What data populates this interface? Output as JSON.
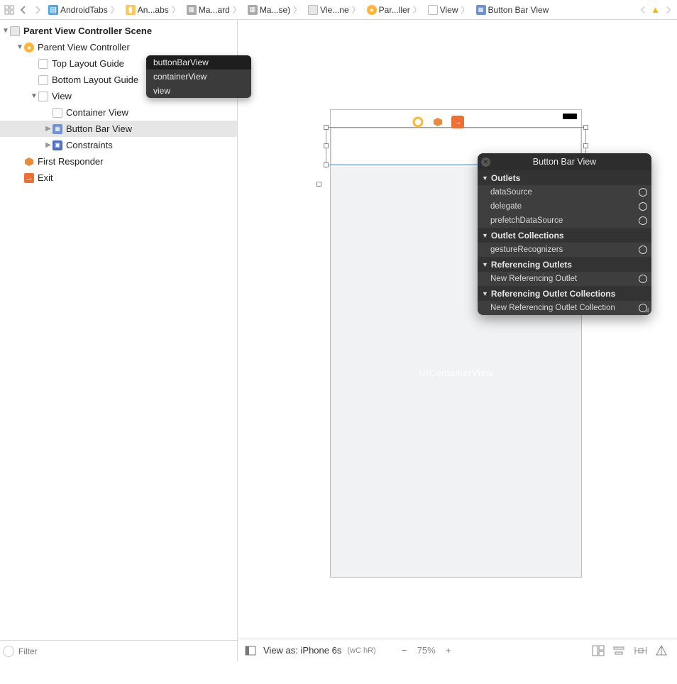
{
  "breadcrumb": {
    "items": [
      {
        "icon": "proj",
        "label": "AndroidTabs"
      },
      {
        "icon": "folder",
        "label": "An...abs"
      },
      {
        "icon": "file",
        "label": "Ma...ard"
      },
      {
        "icon": "file",
        "label": "Ma...se)"
      },
      {
        "icon": "scene",
        "label": "Vie...ne"
      },
      {
        "icon": "vc",
        "label": "Par...ller"
      },
      {
        "icon": "view",
        "label": "View"
      },
      {
        "icon": "grid",
        "label": "Button Bar View"
      }
    ]
  },
  "outline": {
    "scene_header": "Parent View Controller Scene",
    "rows": [
      {
        "label": "Parent View Controller"
      },
      {
        "label": "Top Layout Guide"
      },
      {
        "label": "Bottom Layout Guide"
      },
      {
        "label": "View"
      },
      {
        "label": "Container View"
      },
      {
        "label": "Button Bar View"
      },
      {
        "label": "Constraints"
      },
      {
        "label": "First Responder"
      },
      {
        "label": "Exit"
      }
    ]
  },
  "popover": {
    "items": [
      "buttonBarView",
      "containerView",
      "view"
    ]
  },
  "filter": {
    "placeholder": "Filter"
  },
  "canvas": {
    "placeholder": "UIContainerView"
  },
  "connections": {
    "title": "Button Bar View",
    "sections": [
      {
        "name": "Outlets",
        "items": [
          "dataSource",
          "delegate",
          "prefetchDataSource"
        ]
      },
      {
        "name": "Outlet Collections",
        "items": [
          "gestureRecognizers"
        ]
      },
      {
        "name": "Referencing Outlets",
        "items": [
          "New Referencing Outlet"
        ]
      },
      {
        "name": "Referencing Outlet Collections",
        "items": [
          "New Referencing Outlet Collection"
        ]
      }
    ]
  },
  "bottombar": {
    "view_as": "View as: iPhone 6s",
    "size_class": "(wC hR)",
    "zoom": "75%"
  }
}
